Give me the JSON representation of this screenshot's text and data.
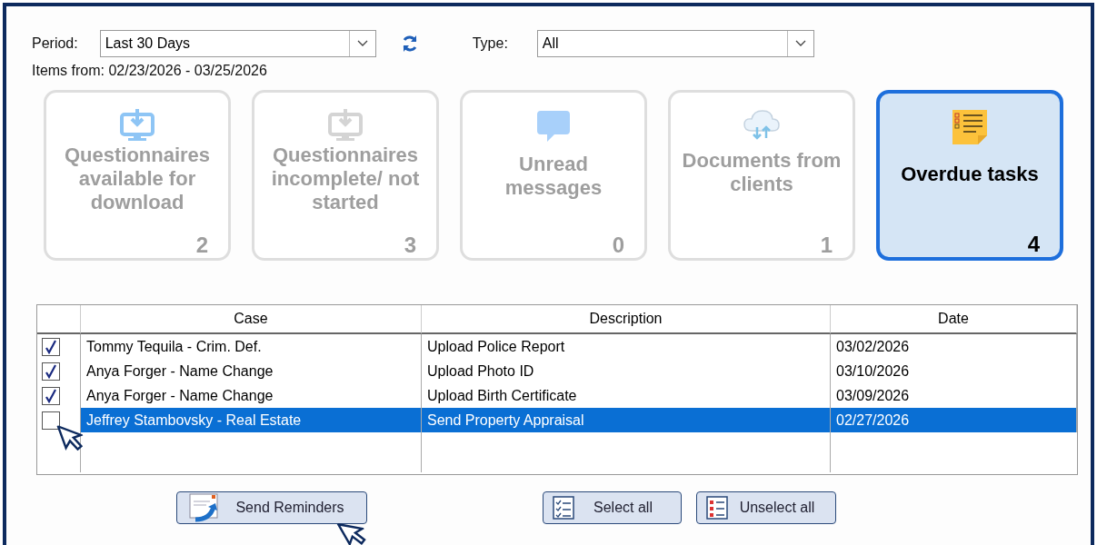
{
  "filters": {
    "period_label": "Period:",
    "period_value": "Last 30 Days",
    "type_label": "Type:",
    "type_value": "All",
    "items_from": "Items from: 02/23/2026 - 03/25/2026"
  },
  "cards": [
    {
      "kind": "download",
      "label": "Questionnaires available for download",
      "count": "2",
      "selected": false
    },
    {
      "kind": "download-muted",
      "label": "Questionnaires incomplete/ not started",
      "count": "3",
      "selected": false
    },
    {
      "kind": "message",
      "label": "Unread messages",
      "count": "0",
      "selected": false
    },
    {
      "kind": "cloud",
      "label": "Documents from clients",
      "count": "1",
      "selected": false
    },
    {
      "kind": "note",
      "label": "Overdue tasks",
      "count": "4",
      "selected": true
    }
  ],
  "table": {
    "columns": [
      "Case",
      "Description",
      "Date"
    ],
    "rows": [
      {
        "checked": true,
        "selected": false,
        "case": "Tommy Tequila - Crim. Def.",
        "description": "Upload Police Report",
        "date": "03/02/2026"
      },
      {
        "checked": true,
        "selected": false,
        "case": "Anya Forger - Name Change",
        "description": "Upload Photo ID",
        "date": "03/10/2026"
      },
      {
        "checked": true,
        "selected": false,
        "case": "Anya Forger - Name Change",
        "description": "Upload Birth Certificate",
        "date": "03/09/2026"
      },
      {
        "checked": false,
        "selected": true,
        "case": "Jeffrey Stambovsky - Real Estate",
        "description": "Send Property Appraisal",
        "date": "02/27/2026"
      }
    ]
  },
  "buttons": [
    {
      "kind": "send",
      "label": "Send Reminders"
    },
    {
      "kind": "select",
      "label": "Select all"
    },
    {
      "kind": "unselect",
      "label": "Unselect all"
    }
  ]
}
